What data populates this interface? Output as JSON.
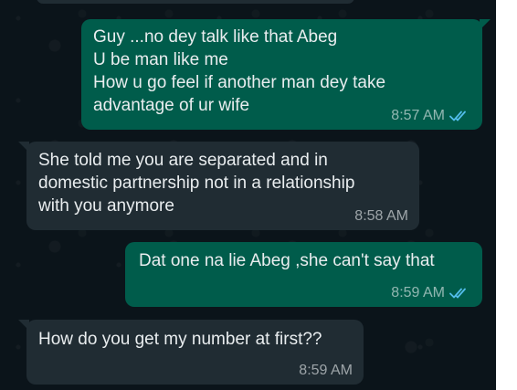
{
  "messages": [
    {
      "direction": "outgoing",
      "text": "Guy ...no dey talk like that Abeg\nU be man like me\nHow u go feel if another man dey take\nadvantage of ur wife",
      "time": "8:57 AM",
      "status_icon": "double-check-read-icon",
      "status_color": "#53bdeb"
    },
    {
      "direction": "incoming",
      "text": "She told me you are separated and in\ndomestic partnership not in a relationship\nwith you anymore",
      "time": "8:58 AM"
    },
    {
      "direction": "outgoing",
      "text": "Dat one na lie Abeg ,she can't say that",
      "time": "8:59 AM",
      "status_icon": "double-check-read-icon",
      "status_color": "#53bdeb"
    },
    {
      "direction": "incoming",
      "text": "How do you get my number at first??",
      "time": "8:59 AM"
    }
  ],
  "colors": {
    "chat_background": "#0b141a",
    "outgoing_bubble": "#005c4b",
    "incoming_bubble": "#202c33",
    "text": "#e9edef"
  }
}
